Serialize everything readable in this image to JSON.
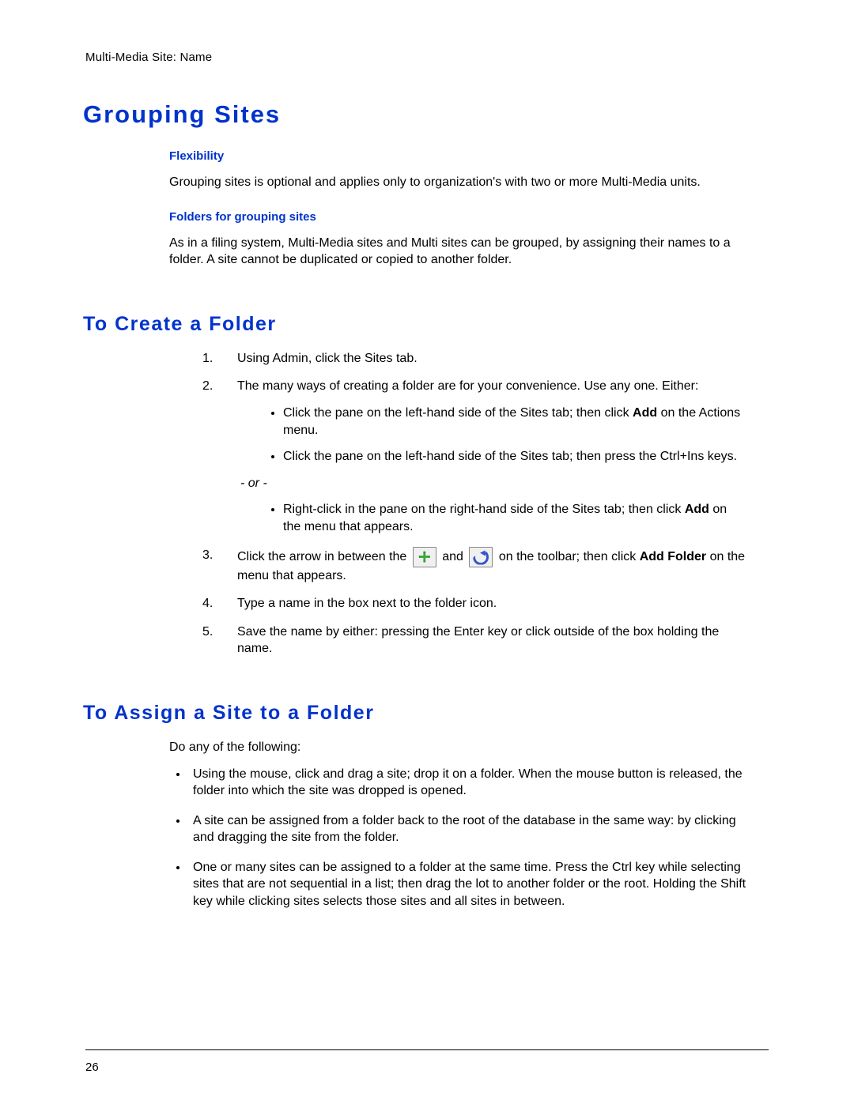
{
  "breadcrumb": "Multi-Media Site: Name",
  "heading_main": "Grouping Sites",
  "subtitle_flex": "Flexibility",
  "para_flex": "Grouping sites is optional and applies only to organization's with two or more Multi-Media units.",
  "subtitle_folders": "Folders for grouping sites",
  "para_folders": "As in a filing system, Multi-Media sites and Multi sites can be grouped, by assigning their names to a folder. A site cannot be duplicated or copied to another folder.",
  "heading_create": "To Create a Folder",
  "create_steps": {
    "s1": "Using Admin, click the Sites tab.",
    "s2": "The many ways of creating a folder are for your convenience. Use any one. Either:",
    "s2_b1a": "Click the pane on the left-hand side of the Sites tab; then click ",
    "s2_b1_bold": "Add",
    "s2_b1b": " on the Actions menu.",
    "s2_b2": "Click the pane on the left-hand side of the Sites tab; then press the Ctrl+Ins keys.",
    "s2_or": "- or -",
    "s2_b3a": "Right-click in the pane on the right-hand side of the Sites tab; then click ",
    "s2_b3_bold": "Add",
    "s2_b3b": " on the menu that appears.",
    "s3a": "Click the arrow in between the ",
    "s3b": " and ",
    "s3c": " on the toolbar; then click ",
    "s3_bold": "Add Folder",
    "s3d": " on the menu that appears.",
    "s4": "Type a name in the box next to the folder icon.",
    "s5": "Save the name by either: pressing the Enter key or click outside of the box holding the name."
  },
  "heading_assign": "To Assign a Site to a Folder",
  "assign_intro": "Do any of the following:",
  "assign_bullets": {
    "b1": "Using the mouse, click and drag a site; drop it on a folder. When the mouse button is released, the folder into which the site was dropped is opened.",
    "b2": "A site can be assigned from a folder back to the root of the database in the same way: by clicking and dragging the site from the folder.",
    "b3": "One or many sites can be assigned to a folder at the same time. Press the Ctrl key while selecting sites that are not sequential in a list; then drag the lot to another folder or the root. Holding the Shift key while clicking sites selects those sites and all sites in between."
  },
  "page_number": "26"
}
